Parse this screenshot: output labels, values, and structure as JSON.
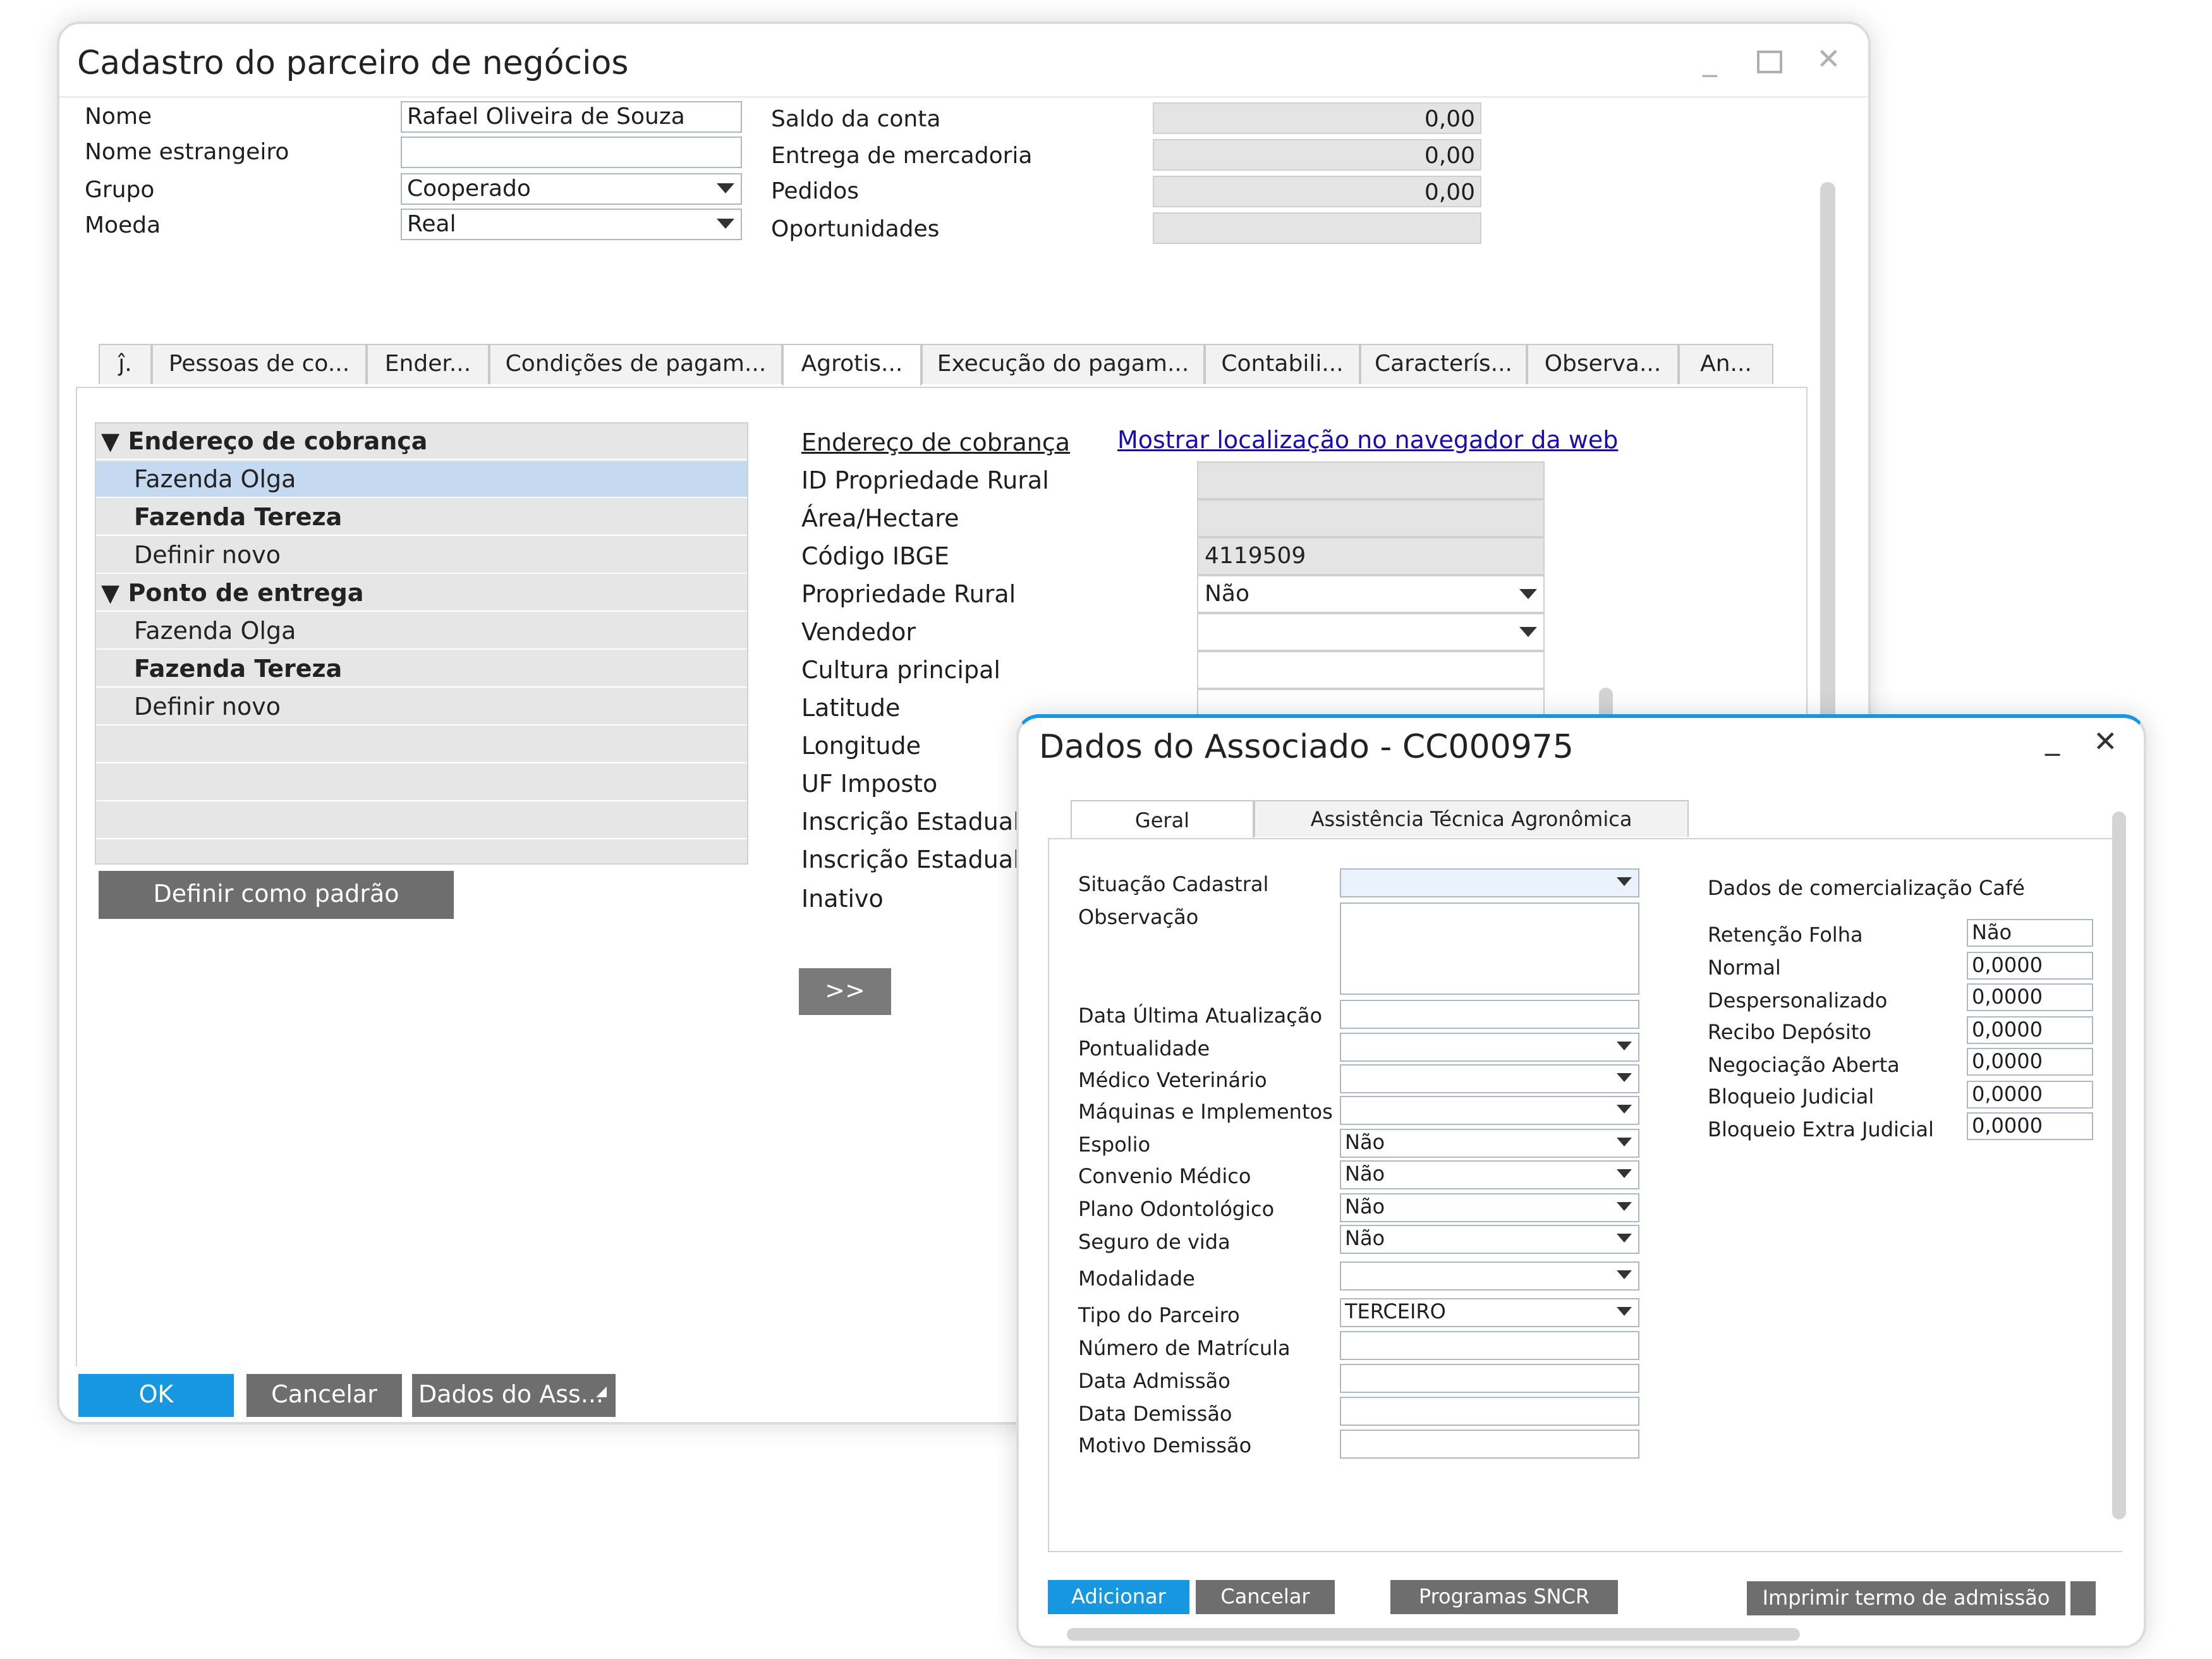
{
  "main_window": {
    "title": "Cadastro do parceiro de negócios",
    "header": {
      "nome_label": "Nome",
      "nome_value": "Rafael Oliveira de Souza",
      "nome_estrangeiro_label": "Nome estrangeiro",
      "nome_estrangeiro_value": "",
      "grupo_label": "Grupo",
      "grupo_value": "Cooperado",
      "moeda_label": "Moeda",
      "moeda_value": "Real",
      "saldo_label": "Saldo da conta",
      "saldo_value": "0,00",
      "entrega_label": "Entrega de mercadoria",
      "entrega_value": "0,00",
      "pedidos_label": "Pedidos",
      "pedidos_value": "0,00",
      "oportunidades_label": "Oportunidades",
      "oportunidades_value": ""
    },
    "tabs": [
      "ĵ.",
      "Pessoas de co...",
      "Ender...",
      "Condições de pagam...",
      "Agrotis...",
      "Execução do pagam...",
      "Contabili...",
      "Caracterís...",
      "Observa...",
      "An..."
    ],
    "active_tab": "Agrotis...",
    "tree": [
      {
        "label": "Endereço de cobrança",
        "bold": true,
        "group": true
      },
      {
        "label": "Fazenda Olga",
        "bold": false,
        "selected": true
      },
      {
        "label": "Fazenda Tereza",
        "bold": true
      },
      {
        "label": "Definir novo",
        "bold": false
      },
      {
        "label": "Ponto de entrega",
        "bold": true,
        "group": true
      },
      {
        "label": "Fazenda Olga",
        "bold": false
      },
      {
        "label": "Fazenda Tereza",
        "bold": true
      },
      {
        "label": "Definir novo",
        "bold": false
      },
      {
        "label": ""
      },
      {
        "label": ""
      },
      {
        "label": ""
      }
    ],
    "definir_padrao_button": "Definir como padrão",
    "details": {
      "link_cobranca": "Endereço de cobrança",
      "link_mapa": "Mostrar localização no navegador da web",
      "rows": [
        {
          "label": "ID Propriedade Rural",
          "value": "",
          "dropdown": false,
          "readonly": true
        },
        {
          "label": "Área/Hectare",
          "value": "",
          "dropdown": false,
          "readonly": true
        },
        {
          "label": "Código IBGE",
          "value": "4119509",
          "dropdown": false,
          "readonly": true
        },
        {
          "label": "Propriedade Rural",
          "value": "Não",
          "dropdown": true,
          "readonly": false
        },
        {
          "label": "Vendedor",
          "value": "",
          "dropdown": true,
          "readonly": false
        },
        {
          "label": "Cultura principal",
          "value": "",
          "dropdown": false,
          "readonly": false
        },
        {
          "label": "Latitude",
          "value": "",
          "dropdown": false,
          "readonly": false
        },
        {
          "label": "Longitude",
          "value": "",
          "dropdown": false,
          "readonly": false
        },
        {
          "label": "UF Imposto",
          "value": "",
          "dropdown": false,
          "readonly": false
        },
        {
          "label": "Inscrição Estadual",
          "value": "",
          "dropdown": false,
          "readonly": false
        },
        {
          "label": "Inscrição Estadual",
          "value": "",
          "dropdown": false,
          "readonly": false
        },
        {
          "label": "Inativo",
          "value": "",
          "dropdown": false,
          "readonly": false
        }
      ],
      "more_button": ">>"
    },
    "footer": {
      "ok": "OK",
      "cancelar": "Cancelar",
      "dados_assoc": "Dados do Ass..."
    }
  },
  "dialog": {
    "title": "Dados do Associado - CC000975",
    "tabs": [
      "Geral",
      "Assistência Técnica Agronômica"
    ],
    "active_tab": "Geral",
    "left_fields": [
      {
        "label": "Situação Cadastral",
        "value": "",
        "dropdown": true
      },
      {
        "label": "Observação",
        "value": "",
        "multiline": true
      },
      {
        "label": "Data Última Atualização",
        "value": "",
        "dropdown": false
      },
      {
        "label": "Pontualidade",
        "value": "",
        "dropdown": true
      },
      {
        "label": "Médico Veterinário",
        "value": "",
        "dropdown": true
      },
      {
        "label": "Máquinas e Implementos",
        "value": "",
        "dropdown": true
      },
      {
        "label": "Espolio",
        "value": "Não",
        "dropdown": true
      },
      {
        "label": "Convenio Médico",
        "value": "Não",
        "dropdown": true
      },
      {
        "label": "Plano Odontológico",
        "value": "Não",
        "dropdown": true
      },
      {
        "label": "Seguro de vida",
        "value": "Não",
        "dropdown": true
      },
      {
        "label": "Modalidade",
        "value": "",
        "dropdown": true
      },
      {
        "label": "Tipo do Parceiro",
        "value": "TERCEIRO",
        "dropdown": true
      },
      {
        "label": "Número de Matrícula",
        "value": "",
        "dropdown": false
      },
      {
        "label": "Data Admissão",
        "value": "",
        "dropdown": false
      },
      {
        "label": "Data Demissão",
        "value": "",
        "dropdown": false
      },
      {
        "label": "Motivo Demissão",
        "value": "",
        "dropdown": false
      }
    ],
    "cafe_title": "Dados de comercialização Café",
    "cafe_fields": [
      {
        "label": "Retenção Folha",
        "value": "Não"
      },
      {
        "label": "Normal",
        "value": "0,0000"
      },
      {
        "label": "Despersonalizado",
        "value": "0,0000"
      },
      {
        "label": "Recibo Depósito",
        "value": "0,0000"
      },
      {
        "label": "Negociação Aberta",
        "value": "0,0000"
      },
      {
        "label": "Bloqueio Judicial",
        "value": "0,0000"
      },
      {
        "label": "Bloqueio Extra Judicial",
        "value": "0,0000"
      }
    ],
    "buttons": {
      "adicionar": "Adicionar",
      "cancelar": "Cancelar",
      "programas": "Programas SNCR",
      "imprimir": "Imprimir termo de admissão"
    }
  },
  "colors": {
    "accent": "#1797e0",
    "button_gray": "#6e6e6e",
    "selected_row": "#c5daf0",
    "link": "#1a0dab"
  }
}
